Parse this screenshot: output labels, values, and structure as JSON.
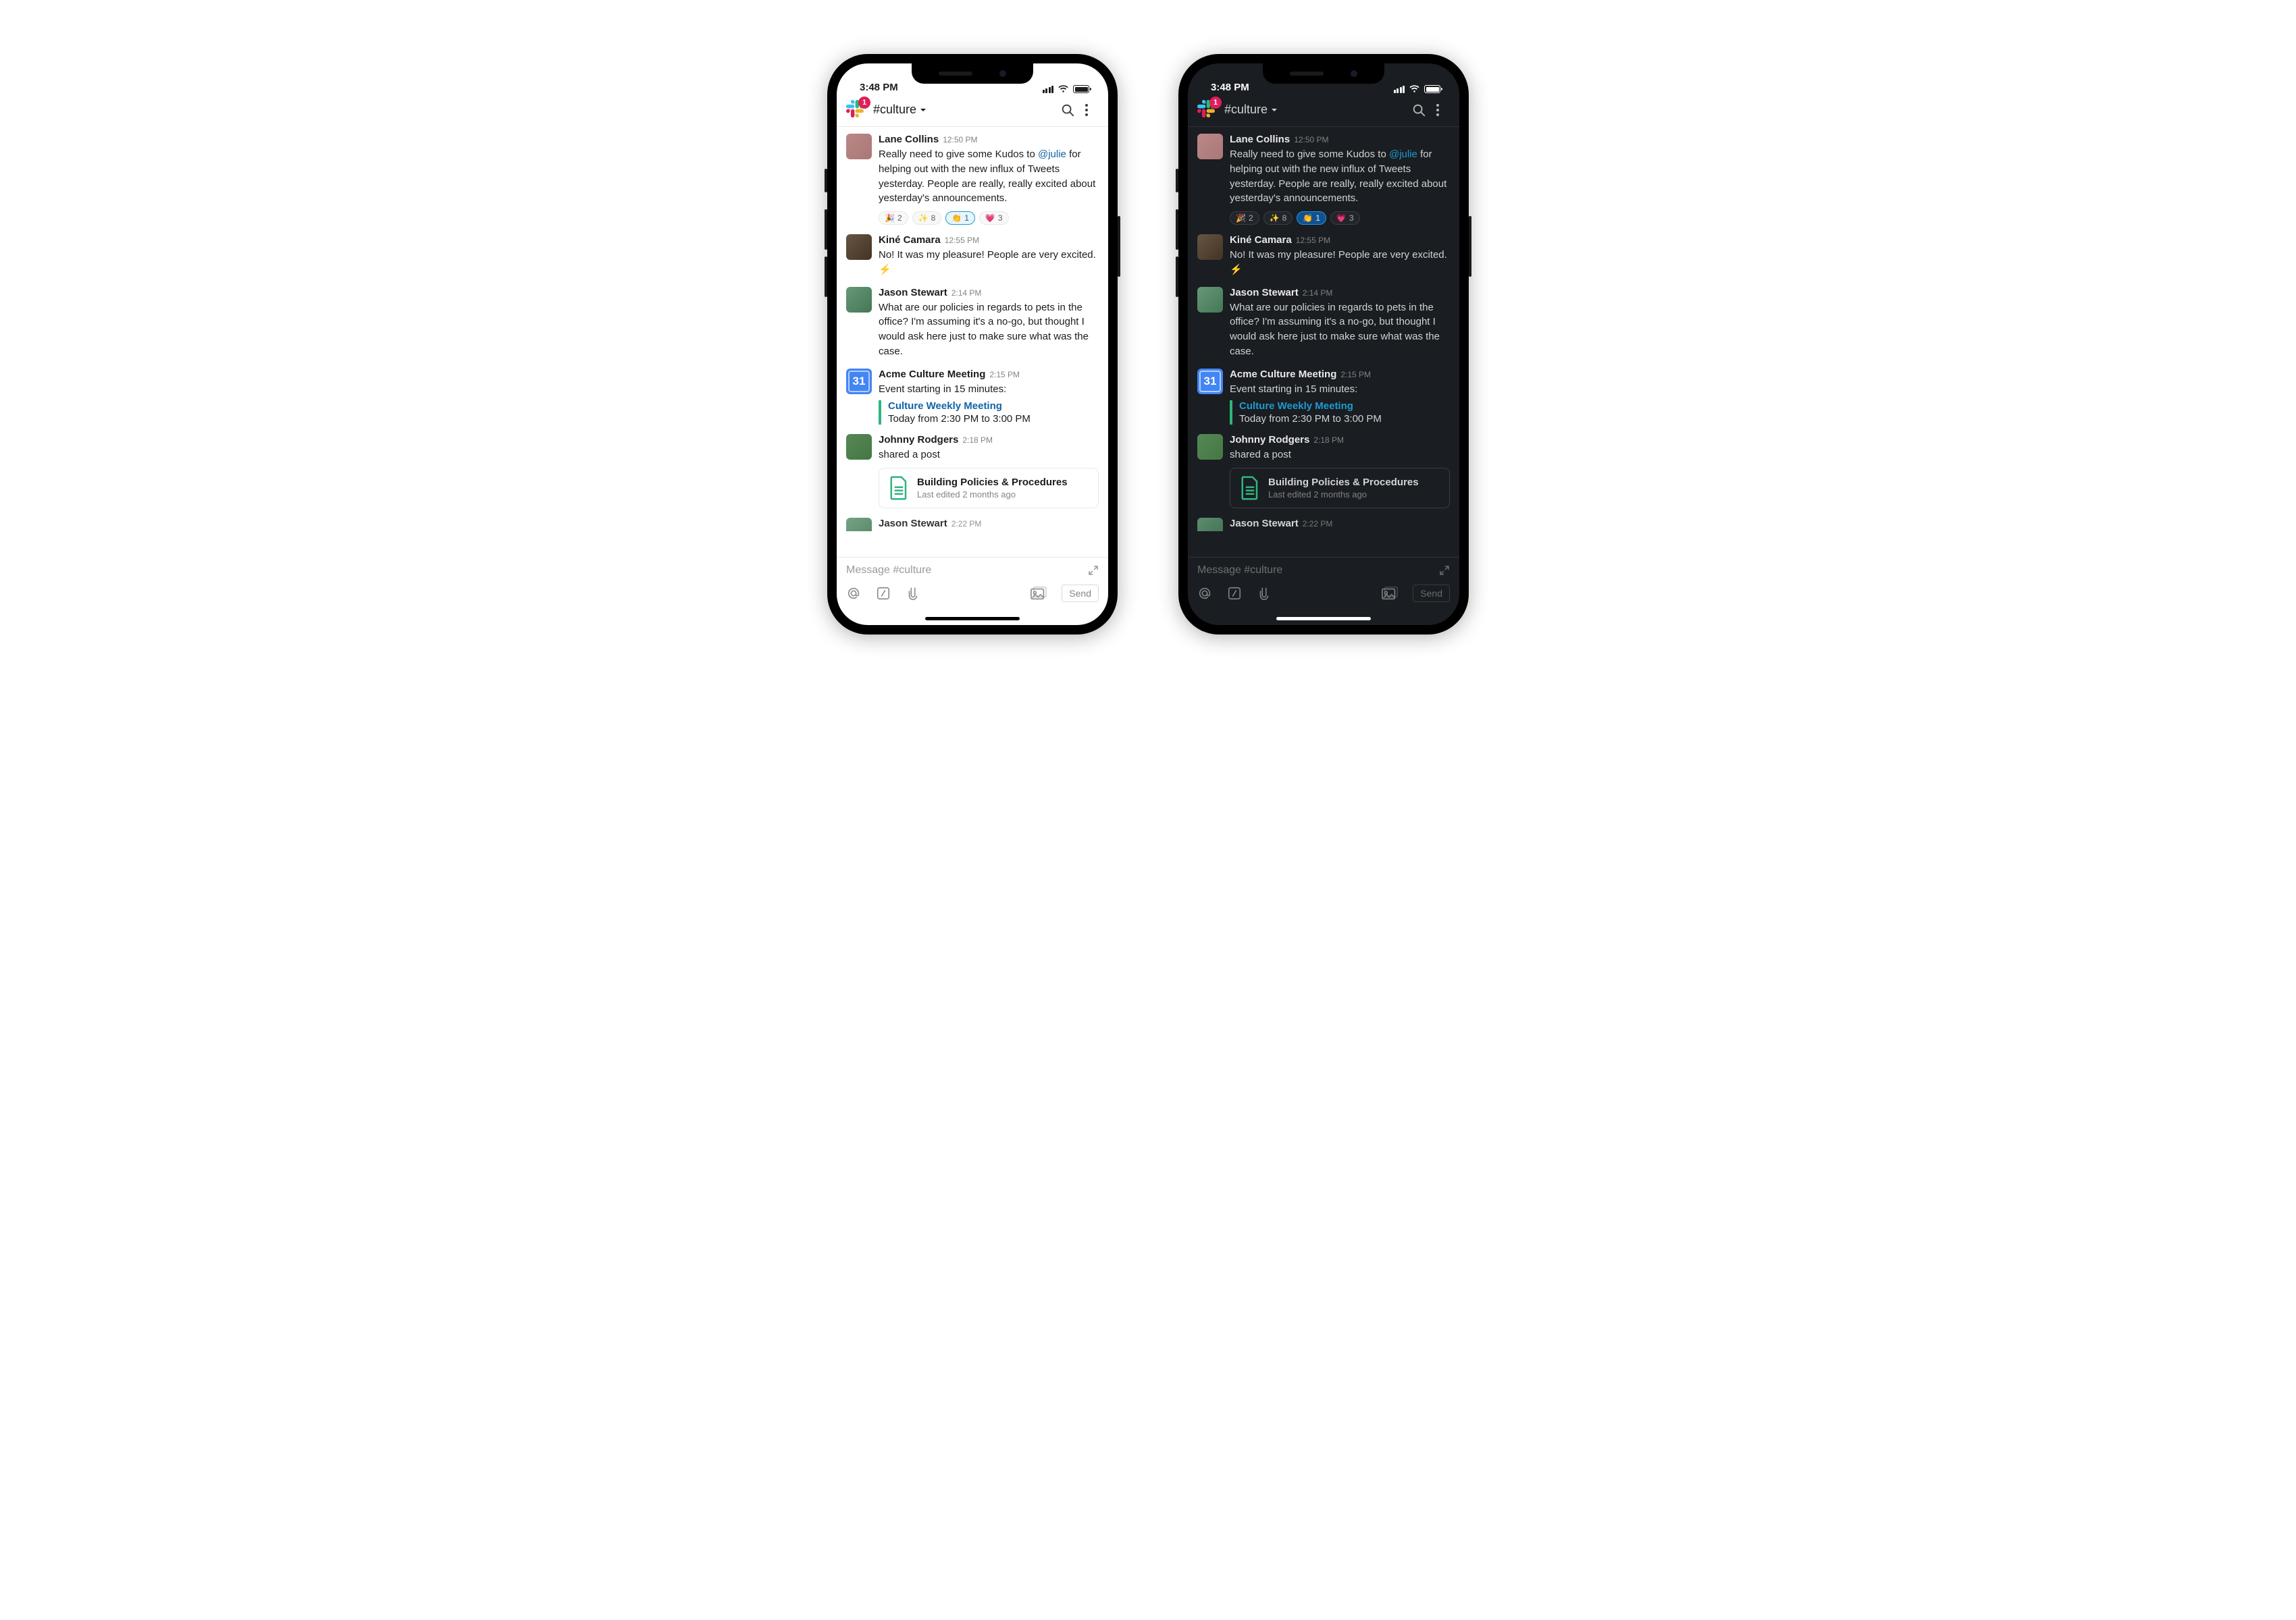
{
  "status": {
    "time": "3:48 PM"
  },
  "header": {
    "badge": "1",
    "channel": "#culture"
  },
  "messages": [
    {
      "sender": "Lane Collins",
      "time": "12:50 PM",
      "body_pre": "Really need to give some Kudos to ",
      "mention": "@julie",
      "body_post": " for helping out with the new influx of Tweets yesterday. People are really, really excited about yesterday's announcements.",
      "reactions": [
        {
          "emoji": "🎉",
          "count": "2",
          "sel": false
        },
        {
          "emoji": "✨",
          "count": "8",
          "sel": false
        },
        {
          "emoji": "👏",
          "count": "1",
          "sel": true
        },
        {
          "emoji": "💗",
          "count": "3",
          "sel": false
        }
      ]
    },
    {
      "sender": "Kiné Camara",
      "time": "12:55 PM",
      "body": "No! It was my pleasure! People are very excited.  ⚡"
    },
    {
      "sender": "Jason Stewart",
      "time": "2:14 PM",
      "body": "What are our policies in regards to pets in the office? I'm assuming it's a no-go, but thought I would ask here just to make sure what was the case."
    },
    {
      "sender": "Acme Culture Meeting",
      "time": "2:15 PM",
      "body": "Event starting in 15 minutes:",
      "event": {
        "title": "Culture Weekly Meeting",
        "sub": "Today from 2:30 PM to 3:00 PM"
      },
      "cal_day": "31"
    },
    {
      "sender": "Johnny Rodgers",
      "time": "2:18 PM",
      "body": "shared a post",
      "attachment": {
        "title": "Building Policies & Procedures",
        "sub": "Last edited 2 months ago"
      }
    },
    {
      "sender": "Jason Stewart",
      "time": "2:22 PM"
    }
  ],
  "composer": {
    "placeholder": "Message #culture",
    "send": "Send"
  }
}
